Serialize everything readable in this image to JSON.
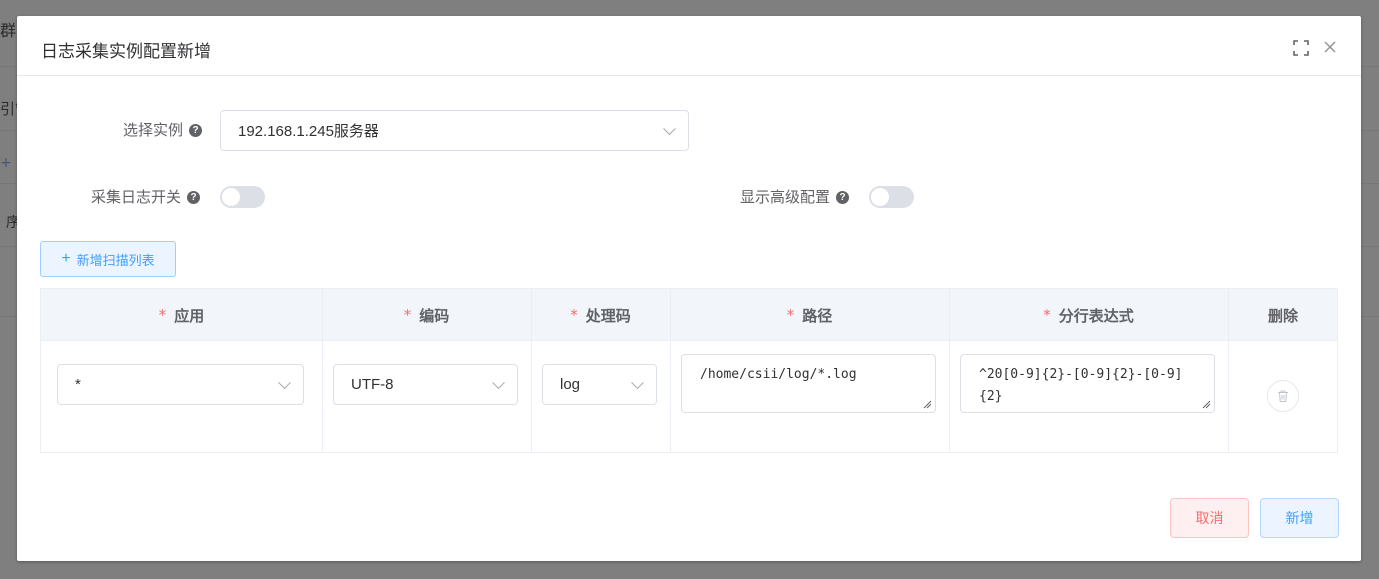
{
  "background": {
    "fragments": [
      "群",
      "引管",
      "+",
      "序"
    ]
  },
  "dialog": {
    "title": "日志采集实例配置新增",
    "fullscreen_icon": "fullscreen-icon",
    "close_icon": "close-icon"
  },
  "form": {
    "instance_label": "选择实例",
    "instance_value": "192.168.1.245服务器",
    "log_switch_label": "采集日志开关",
    "log_switch_on": false,
    "advanced_label": "显示高级配置",
    "advanced_on": false,
    "help_glyph": "?"
  },
  "add_scan_button": {
    "label": "新增扫描列表",
    "plus": "+"
  },
  "table": {
    "required_mark": "*",
    "headers": {
      "app": "应用",
      "encoding": "编码",
      "handler": "处理码",
      "path": "路径",
      "line_expr": "分行表达式",
      "delete": "删除"
    },
    "rows": [
      {
        "app": "*",
        "encoding": "UTF-8",
        "handler": "log",
        "path": "/home/csii/log/*.log",
        "line_expr": "^20[0-9]{2}-[0-9]{2}-[0-9]{2}"
      }
    ]
  },
  "footer": {
    "cancel_label": "取消",
    "add_label": "新增"
  },
  "colors": {
    "primary": "#409eff",
    "danger": "#f56c6c",
    "required": "#f56c6c",
    "overlay": "#7f7f7f"
  }
}
